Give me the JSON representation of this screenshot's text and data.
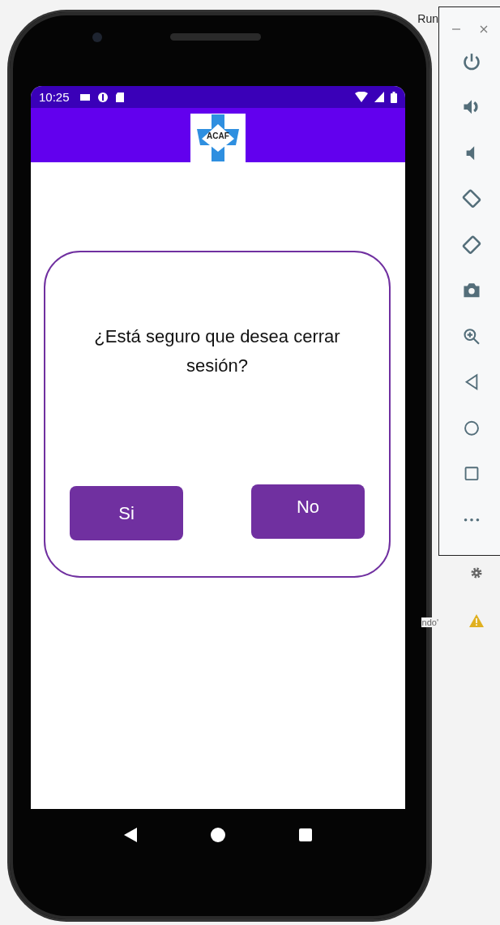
{
  "ide": {
    "menu_item": "Run",
    "message_fragment": "ndo'"
  },
  "status_bar": {
    "time": "10:25"
  },
  "app_bar": {
    "logo_text": "ACAF"
  },
  "dialog": {
    "message": "¿Está seguro que desea cerrar sesión?",
    "buttons": [
      {
        "label": "Si"
      },
      {
        "label": "No"
      }
    ]
  }
}
